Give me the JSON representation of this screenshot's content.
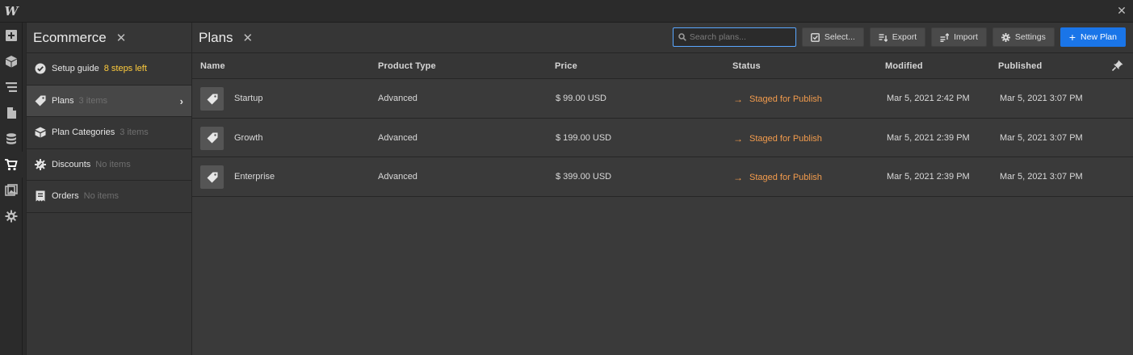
{
  "app": {
    "logo_text": "W",
    "close_icon": "close-icon"
  },
  "rail": {
    "items": [
      {
        "name": "add-icon"
      },
      {
        "name": "box-icon"
      },
      {
        "name": "navigator-icon"
      },
      {
        "name": "pages-icon"
      },
      {
        "name": "cms-icon"
      },
      {
        "name": "ecommerce-cart-icon",
        "active": true
      },
      {
        "name": "assets-icon"
      },
      {
        "name": "settings-gear-icon"
      }
    ]
  },
  "panel": {
    "title": "Ecommerce",
    "items": [
      {
        "label": "Setup guide",
        "count": "8 steps left",
        "icon": "check-circle-icon"
      },
      {
        "label": "Plans",
        "count": "3 items",
        "icon": "tag-icon",
        "selected": true
      },
      {
        "label": "Plan Categories",
        "count": "3 items",
        "icon": "categories-icon"
      },
      {
        "label": "Discounts",
        "count": "No items",
        "icon": "discount-badge-icon"
      },
      {
        "label": "Orders",
        "count": "No items",
        "icon": "receipt-icon"
      }
    ]
  },
  "main": {
    "title": "Plans",
    "search_placeholder": "Search plans...",
    "buttons": {
      "select": "Select...",
      "export": "Export",
      "import": "Import",
      "settings": "Settings",
      "new": "New Plan"
    },
    "accent_color": "#1a75e8",
    "status_color": "#f39c4d",
    "columns": [
      "Name",
      "Product Type",
      "Price",
      "Status",
      "Modified",
      "Published"
    ],
    "rows": [
      {
        "name": "Startup",
        "type": "Advanced",
        "price": "$ 99.00 USD",
        "status": "Staged for Publish",
        "modified": "Mar 5, 2021 2:42 PM",
        "published": "Mar 5, 2021 3:07 PM"
      },
      {
        "name": "Growth",
        "type": "Advanced",
        "price": "$ 199.00 USD",
        "status": "Staged for Publish",
        "modified": "Mar 5, 2021 2:39 PM",
        "published": "Mar 5, 2021 3:07 PM"
      },
      {
        "name": "Enterprise",
        "type": "Advanced",
        "price": "$ 399.00 USD",
        "status": "Staged for Publish",
        "modified": "Mar 5, 2021 2:39 PM",
        "published": "Mar 5, 2021 3:07 PM"
      }
    ]
  }
}
